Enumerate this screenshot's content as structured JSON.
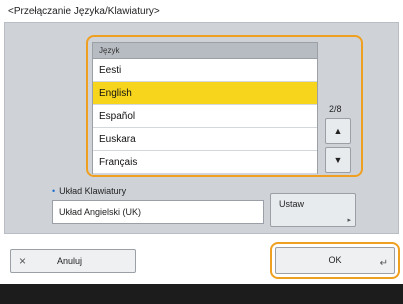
{
  "screen": {
    "title": "<Przełączanie Języka/Klawiatury>"
  },
  "language_list": {
    "header": "Język",
    "items": [
      {
        "label": "Eesti"
      },
      {
        "label": "English"
      },
      {
        "label": "Español"
      },
      {
        "label": "Euskara"
      },
      {
        "label": "Français"
      }
    ],
    "selected": "English",
    "page_counter": "2/8",
    "scroll_up_icon": "triangle-up-icon",
    "scroll_down_icon": "triangle-down-icon"
  },
  "keyboard": {
    "label": "Układ Klawiatury",
    "value": "Układ Angielski (UK)",
    "set_button": "Ustaw"
  },
  "footer": {
    "cancel_icon": "close-icon",
    "cancel_label": "Anuluj",
    "ok_label": "OK"
  },
  "colors": {
    "selected_highlight": "#f7d51c",
    "focus_frame": "#f0a020",
    "panel_background": "#cfd3d8"
  }
}
